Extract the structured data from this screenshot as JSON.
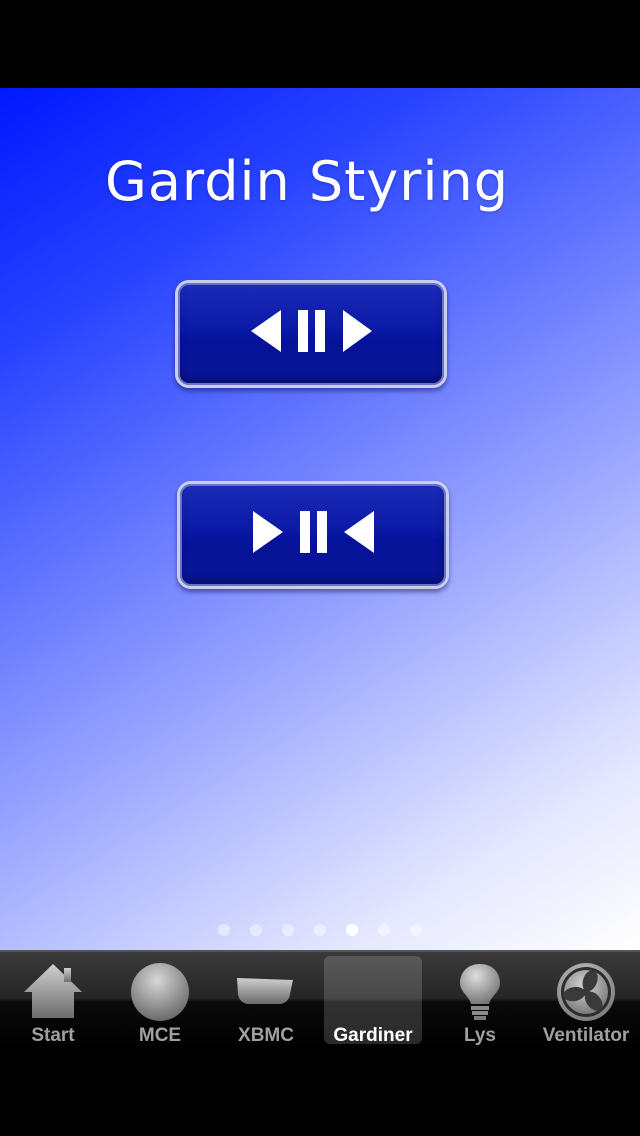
{
  "screen": {
    "title": "Gardin Styring"
  },
  "buttons": {
    "open": {
      "icon": "curtain-open-icon"
    },
    "close": {
      "icon": "curtain-close-icon"
    }
  },
  "pagination": {
    "total": 7,
    "current": 5
  },
  "tab_bar": {
    "tabs": [
      {
        "label": "Start",
        "icon": "home-icon",
        "selected": false
      },
      {
        "label": "MCE",
        "icon": "circle-icon",
        "selected": false
      },
      {
        "label": "XBMC",
        "icon": "xbmc-icon",
        "selected": false
      },
      {
        "label": "Gardiner",
        "icon": "curtains-icon",
        "selected": true
      },
      {
        "label": "Lys",
        "icon": "light-bulb-icon",
        "selected": false
      },
      {
        "label": "Ventilator",
        "icon": "fan-icon",
        "selected": false
      }
    ]
  },
  "colors": {
    "background_top": "#0018ff",
    "background_bottom": "#ffffff",
    "button_fill": "#0a1aa6",
    "tab_bar": "#262626"
  }
}
